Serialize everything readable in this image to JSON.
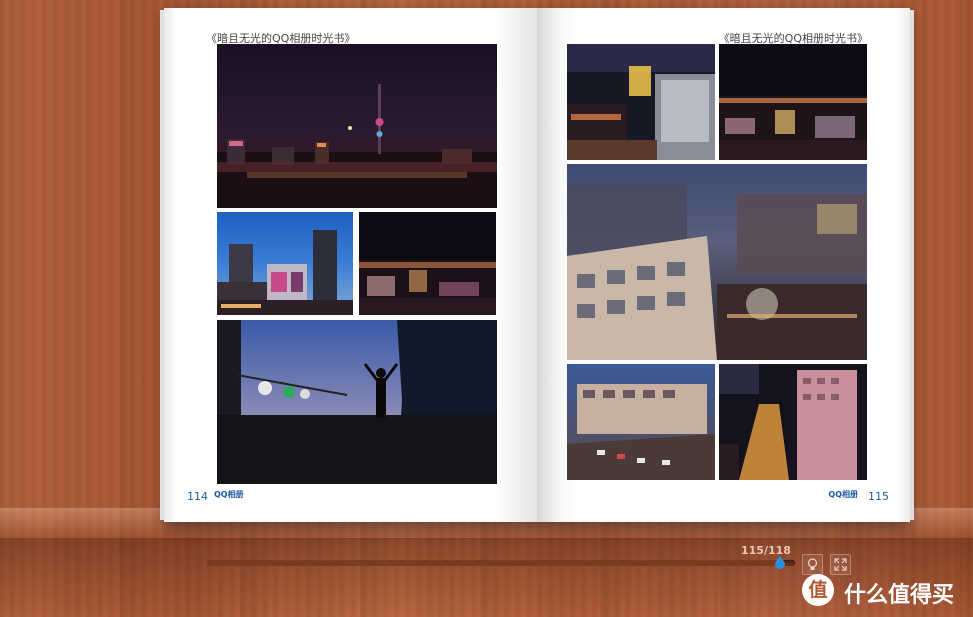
{
  "viewer": {
    "page_counter": "115/118",
    "progress_fraction": 0.9746,
    "buttons": [
      {
        "name": "lightbulb-button",
        "icon": "lightbulb-icon"
      },
      {
        "name": "fullscreen-button",
        "icon": "expand-icon"
      }
    ]
  },
  "book": {
    "left_page": {
      "running_title": "《暗且无光的QQ相册时光书》",
      "page_number": "114",
      "logo_text": "QQ相册",
      "photos": [
        {
          "name": "photo-city-night-tower",
          "subject": "night skyline with TV tower"
        },
        {
          "name": "photo-blue-hour-buildings",
          "subject": "buildings at blue hour"
        },
        {
          "name": "photo-night-street-lights",
          "subject": "night cityscape tilt-shift"
        },
        {
          "name": "photo-rooftop-silhouette",
          "subject": "man silhouette on rooftop at dusk"
        }
      ]
    },
    "right_page": {
      "running_title": "《暗且无光的QQ相册时光书》",
      "page_number": "115",
      "logo_text": "QQ相册",
      "photos": [
        {
          "name": "photo-neon-street",
          "subject": "neon-lit street with shop"
        },
        {
          "name": "photo-city-night-glow",
          "subject": "night city glow"
        },
        {
          "name": "photo-apartment-tiltshift",
          "subject": "apartment buildings at dusk tilt-shift"
        },
        {
          "name": "photo-street-traffic",
          "subject": "street traffic by apartments"
        },
        {
          "name": "photo-night-market-street",
          "subject": "illuminated night market street"
        }
      ]
    }
  },
  "watermark": {
    "circle_glyph": "值",
    "text": "什么值得买"
  },
  "colors": {
    "page_number": "#1e5aa8",
    "progress_track": "#5f2f17",
    "thumb": "#2a8fe0"
  }
}
